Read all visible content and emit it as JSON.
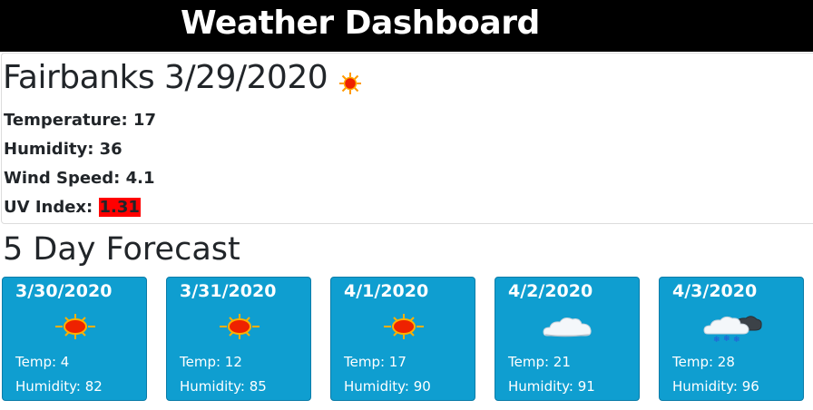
{
  "header": {
    "title": "Weather Dashboard"
  },
  "current": {
    "city_date": "Fairbanks 3/29/2020",
    "icon": "sun-icon",
    "temperature_label": "Temperature: 17",
    "humidity_label": "Humidity: 36",
    "wind_label": "Wind Speed: 4.1",
    "uv_label": "UV Index: ",
    "uv_value": "1.31",
    "uv_color": "#ff0000"
  },
  "forecast": {
    "title": "5 Day Forecast",
    "days": [
      {
        "date": "3/30/2020",
        "icon": "sun-icon",
        "temp": "Temp: 4",
        "humidity": "Humidity: 82"
      },
      {
        "date": "3/31/2020",
        "icon": "sun-icon",
        "temp": "Temp: 12",
        "humidity": "Humidity: 85"
      },
      {
        "date": "4/1/2020",
        "icon": "sun-icon",
        "temp": "Temp: 17",
        "humidity": "Humidity: 90"
      },
      {
        "date": "4/2/2020",
        "icon": "cloud-icon",
        "temp": "Temp: 21",
        "humidity": "Humidity: 91"
      },
      {
        "date": "4/3/2020",
        "icon": "snow-cloud-icon",
        "temp": "Temp: 28",
        "humidity": "Humidity: 96"
      }
    ]
  },
  "colors": {
    "topbar": "#000000",
    "card": "#0f9ed0",
    "uv_badge": "#ff0000"
  }
}
